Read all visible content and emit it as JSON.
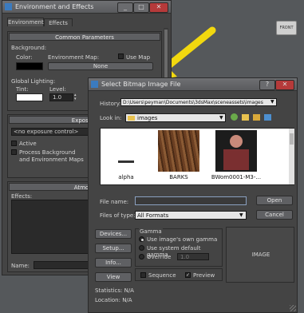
{
  "viewport": {
    "label": "FRONT"
  },
  "env_window": {
    "title": "Environment and Effects",
    "tabs": [
      "Environment",
      "Effects"
    ],
    "common_params": {
      "header": "Common Parameters",
      "background_label": "Background:",
      "color_label": "Color:",
      "env_map_label": "Environment Map:",
      "use_map_label": "Use Map",
      "none_button": "None",
      "global_lighting_label": "Global Lighting:",
      "tint_label": "Tint:",
      "level_label": "Level:",
      "level_value": "1.0"
    },
    "exposure": {
      "header": "Exposure",
      "dropdown_value": "<no exposure control>",
      "active_label": "Active",
      "process_label_1": "Process Background",
      "process_label_2": "and Environment Maps"
    },
    "atmosphere": {
      "header": "Atmosp",
      "effects_label": "Effects:",
      "name_label": "Name:"
    }
  },
  "bitmap_dialog": {
    "title": "Select Bitmap Image File",
    "history_label": "History:",
    "history_value": "D:\\Users\\peyman\\Documents\\3dsMax\\sceneassets\\images",
    "lookin_label": "Look in:",
    "lookin_value": "images",
    "files": [
      {
        "name": "alpha"
      },
      {
        "name": "BARKS"
      },
      {
        "name": "BWom0001-M3-..."
      }
    ],
    "file_name_label": "File name:",
    "file_name_value": "",
    "files_of_type_label": "Files of type:",
    "files_of_type_value": "All Formats",
    "open_button": "Open",
    "cancel_button": "Cancel",
    "devices_button": "Devices...",
    "setup_button": "Setup...",
    "info_button": "Info...",
    "view_button": "View",
    "gamma_label": "Gamma",
    "gamma_options": [
      "Use image's own gamma",
      "Use system default gamma",
      "Override"
    ],
    "override_value": "1.0",
    "sequence_label": "Sequence",
    "preview_label": "Preview",
    "image_label": "IMAGE",
    "statistics": "Statistics: N/A",
    "location": "Location: N/A"
  },
  "colors": {
    "arrow": "#f2d80f",
    "background": "#55585b",
    "panel": "#444444"
  }
}
